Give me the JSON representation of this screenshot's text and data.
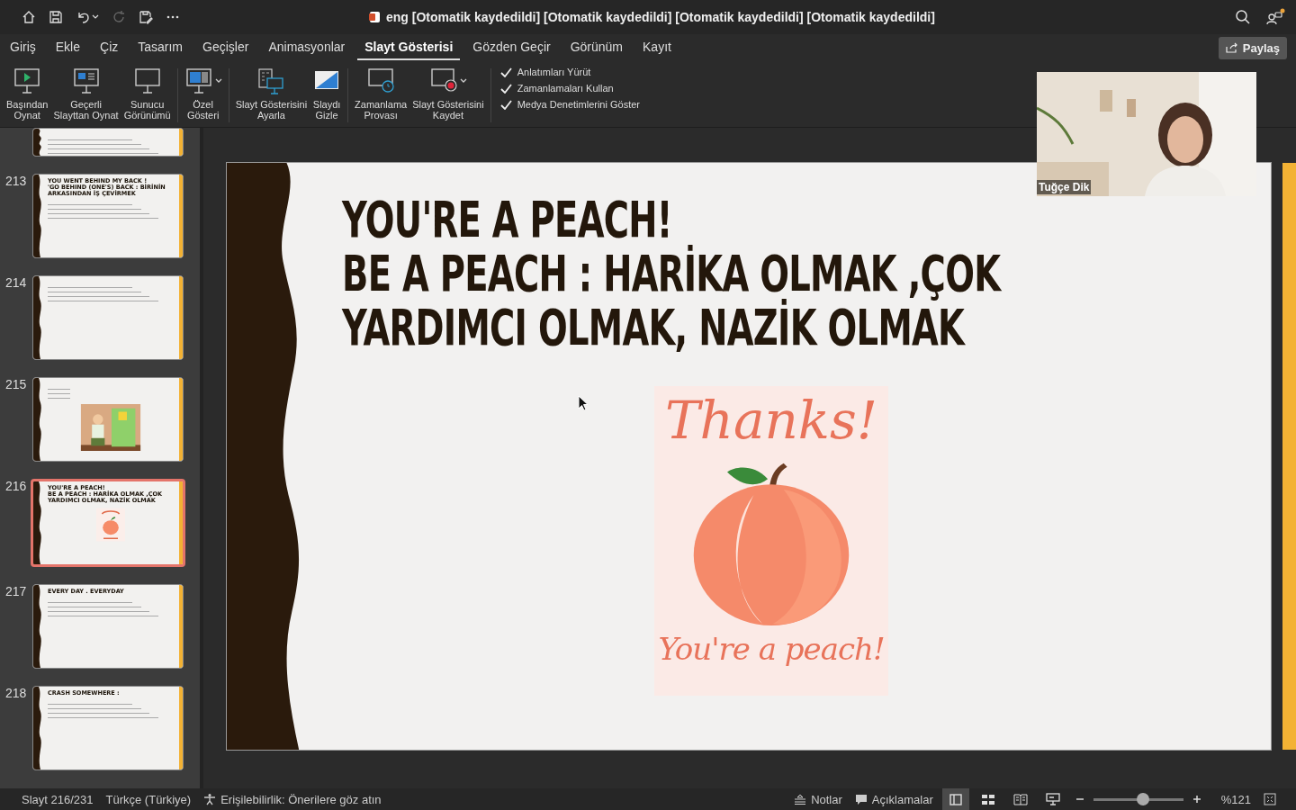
{
  "title_bar": {
    "title": "eng [Otomatik kaydedildi] [Otomatik kaydedildi] [Otomatik kaydedildi] [Otomatik kaydedildi]"
  },
  "tabs": [
    {
      "label": "Giriş",
      "selected": false
    },
    {
      "label": "Ekle",
      "selected": false
    },
    {
      "label": "Çiz",
      "selected": false
    },
    {
      "label": "Tasarım",
      "selected": false
    },
    {
      "label": "Geçişler",
      "selected": false
    },
    {
      "label": "Animasyonlar",
      "selected": false
    },
    {
      "label": "Slayt Gösterisi",
      "selected": true
    },
    {
      "label": "Gözden Geçir",
      "selected": false
    },
    {
      "label": "Görünüm",
      "selected": false
    },
    {
      "label": "Kayıt",
      "selected": false
    }
  ],
  "share_button": "Paylaş",
  "ribbon": {
    "groups": [
      [
        {
          "kind": "play",
          "label": "Başından\nOynat"
        },
        {
          "kind": "current",
          "label": "Geçerli\nSlayttan Oynat"
        },
        {
          "kind": "presenter",
          "label": "Sunucu\nGörünümü"
        }
      ],
      [
        {
          "kind": "custom",
          "label": "Özel\nGösteri",
          "dropdown": true
        }
      ],
      [
        {
          "kind": "setup",
          "label": "Slayt Gösterisini\nAyarla"
        },
        {
          "kind": "hide",
          "label": "Slaydı\nGizle"
        }
      ],
      [
        {
          "kind": "rehearse",
          "label": "Zamanlama\nProvası"
        },
        {
          "kind": "record",
          "label": "Slayt Gösterisini\nKaydet",
          "dropdown": true
        }
      ]
    ],
    "checks": [
      {
        "label": "Anlatımları Yürüt",
        "checked": true
      },
      {
        "label": "Zamanlamaları Kullan",
        "checked": true
      },
      {
        "label": "Medya Denetimlerini Göster",
        "checked": true
      }
    ]
  },
  "thumbnails": [
    {
      "kind": "cut",
      "selected": false
    },
    {
      "number": "213",
      "kind": "text",
      "selected": false,
      "title_lines": [
        "YOU WENT BEHIND MY BACK !",
        "'GO BEHIND (ONE'S) BACK : BİRİNİN",
        "ARKASINDAN İŞ ÇEVİRMEK"
      ]
    },
    {
      "number": "214",
      "kind": "text",
      "selected": false
    },
    {
      "number": "215",
      "kind": "picture",
      "selected": false
    },
    {
      "number": "216",
      "kind": "peach",
      "selected": true,
      "title_lines": [
        "YOU'RE A PEACH!",
        "BE A PEACH  : HARİKA OLMAK ,ÇOK",
        "YARDIMCI OLMAK, NAZİK OLMAK"
      ]
    },
    {
      "number": "217",
      "kind": "text",
      "selected": false,
      "title_lines": [
        "EVERY DAY . EVERYDAY"
      ]
    },
    {
      "number": "218",
      "kind": "text",
      "selected": false,
      "title_lines": [
        "CRASH SOMEWHERE :"
      ]
    }
  ],
  "slide": {
    "title_lines": [
      "YOU'RE A PEACH!",
      "BE A PEACH  : HARİKA OLMAK ,ÇOK",
      "YARDIMCI OLMAK, NAZİK OLMAK"
    ],
    "image": {
      "top_text": "Thanks!",
      "bottom_text": "You're a peach!"
    }
  },
  "video": {
    "name": "Tuğçe Dik"
  },
  "status_bar": {
    "slide": "Slayt 216/231",
    "language": "Türkçe (Türkiye)",
    "accessibility": "Erişilebilirlik: Önerilere göz atın",
    "notes": "Notlar",
    "comments": "Açıklamalar",
    "views": [
      {
        "kind": "normal",
        "selected": true
      },
      {
        "kind": "sorter",
        "selected": false
      },
      {
        "kind": "reading",
        "selected": false
      },
      {
        "kind": "show",
        "selected": false
      }
    ],
    "zoom": {
      "level": 0.55,
      "value": "%121"
    }
  }
}
